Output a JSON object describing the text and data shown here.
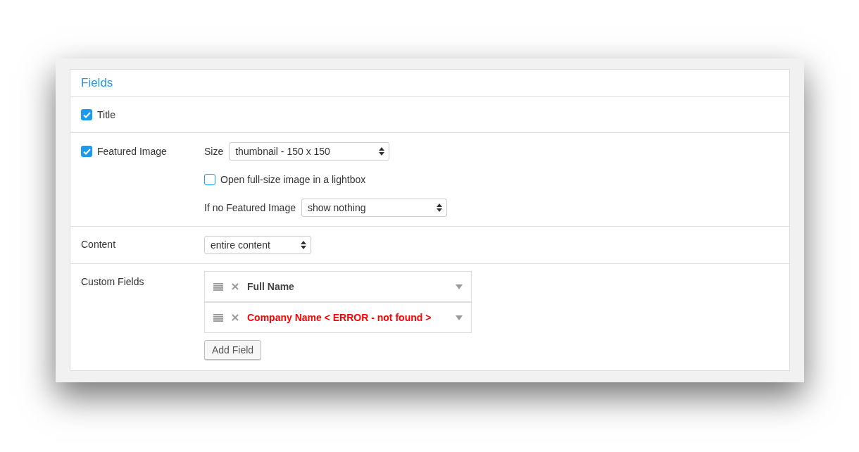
{
  "panel": {
    "title": "Fields"
  },
  "title_field": {
    "label": "Title",
    "checked": true
  },
  "featured_image": {
    "label": "Featured Image",
    "checked": true,
    "size": {
      "label": "Size",
      "value": "thumbnail - 150 x 150"
    },
    "lightbox": {
      "label": "Open full-size image in a lightbox",
      "checked": false
    },
    "fallback": {
      "label": "If no Featured Image",
      "value": "show nothing"
    }
  },
  "content": {
    "label": "Content",
    "value": "entire content"
  },
  "custom_fields": {
    "label": "Custom Fields",
    "items": [
      {
        "name": "Full Name",
        "error": false
      },
      {
        "name": "Company Name < ERROR - not found >",
        "error": true
      }
    ],
    "add_button": "Add Field"
  }
}
